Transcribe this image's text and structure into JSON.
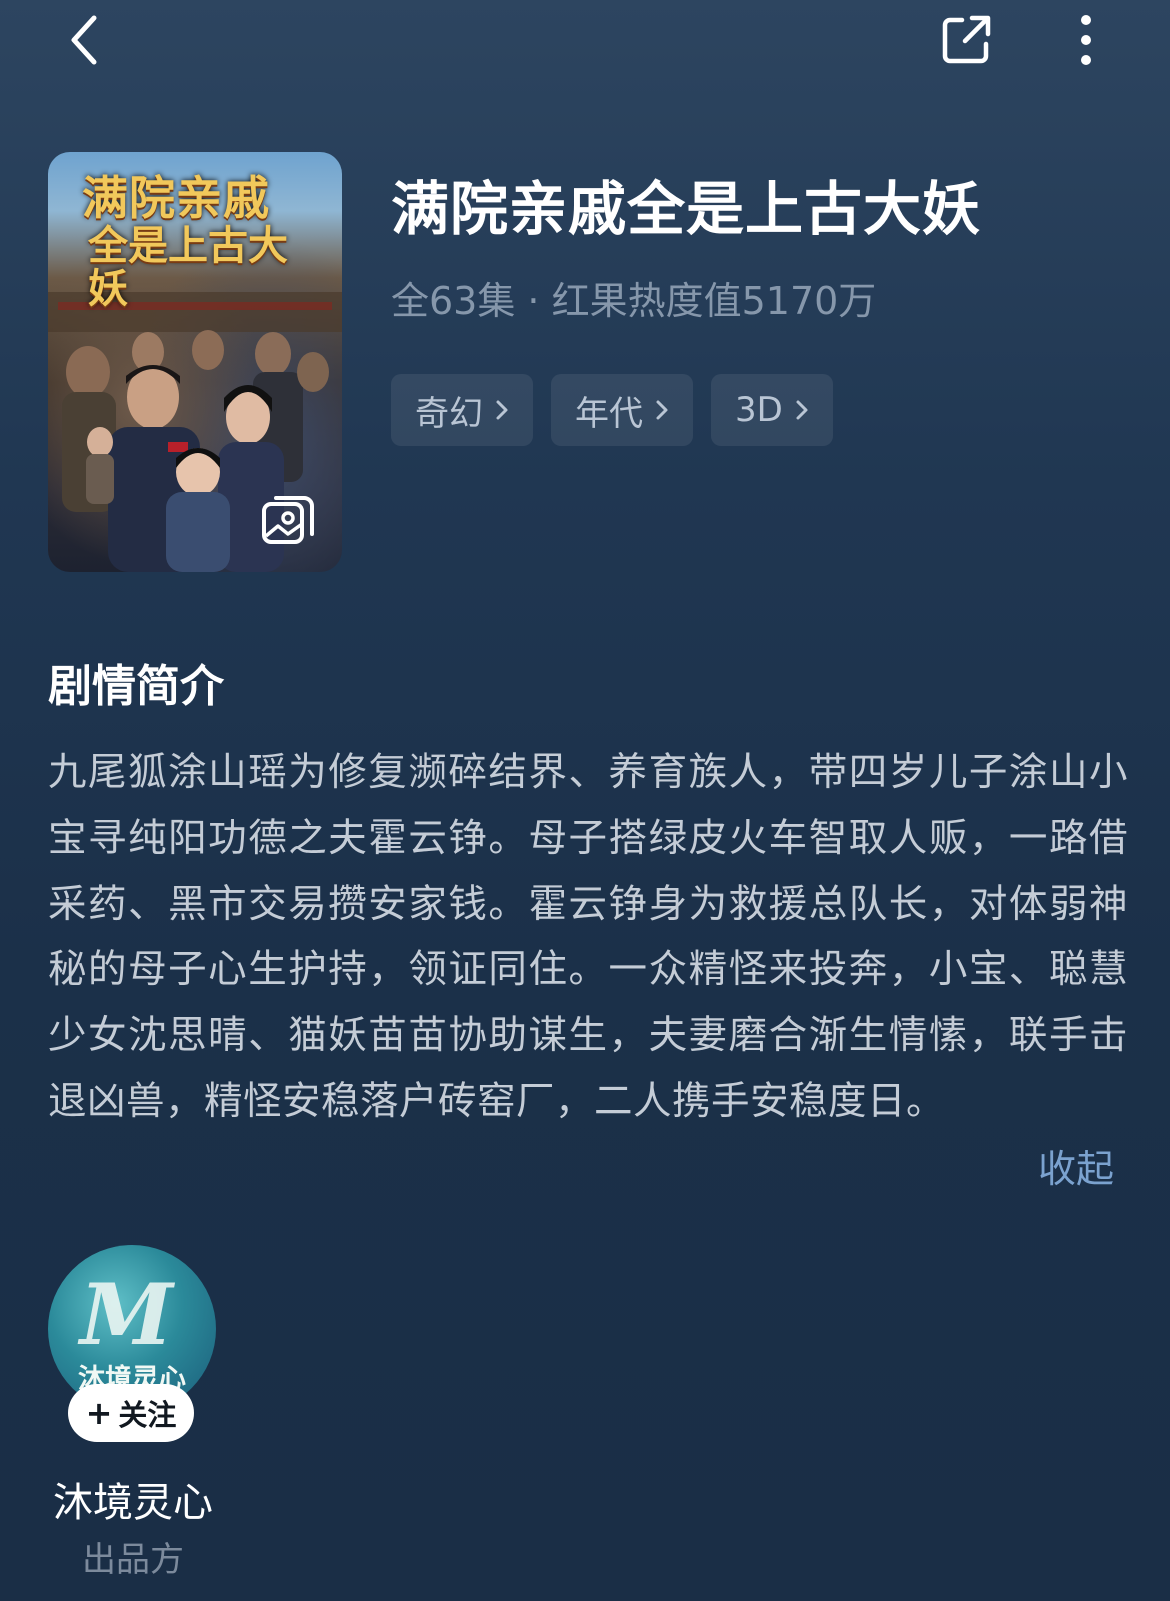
{
  "nav": {
    "back_icon": "chevron-left-icon",
    "share_icon": "share-icon",
    "more_icon": "more-vertical-icon"
  },
  "drama": {
    "poster_title_line1": "满院亲戚",
    "poster_title_line2": "全是上古大妖",
    "title": "满院亲戚全是上古大妖",
    "meta": "全63集 · 红果热度值5170万",
    "tags": [
      {
        "label": "奇幻"
      },
      {
        "label": "年代"
      },
      {
        "label": "3D"
      }
    ]
  },
  "synopsis": {
    "heading": "剧情简介",
    "text": "九尾狐涂山瑶为修复濒碎结界、养育族人，带四岁儿子涂山小宝寻纯阳功德之夫霍云铮。母子搭绿皮火车智取人贩，一路借采药、黑市交易攒安家钱。霍云铮身为救援总队长，对体弱神秘的母子心生护持，领证同住。一众精怪来投奔，小宝、聪慧少女沈思晴、猫妖苗苗协助谋生，夫妻磨合渐生情愫，联手击退凶兽，精怪安稳落户砖窑厂，二人携手安稳度日。",
    "collapse_label": "收起"
  },
  "producer": {
    "avatar_logo_text": "沐境灵心",
    "follow_label": "关注",
    "name": "沐境灵心",
    "role": "出品方"
  },
  "colors": {
    "background_top": "#2d4560",
    "background_bottom": "#1a2e46",
    "meta_text": "#8697ab",
    "link_accent": "#7ba2cf",
    "tag_bg": "rgba(255,255,255,0.08)"
  }
}
